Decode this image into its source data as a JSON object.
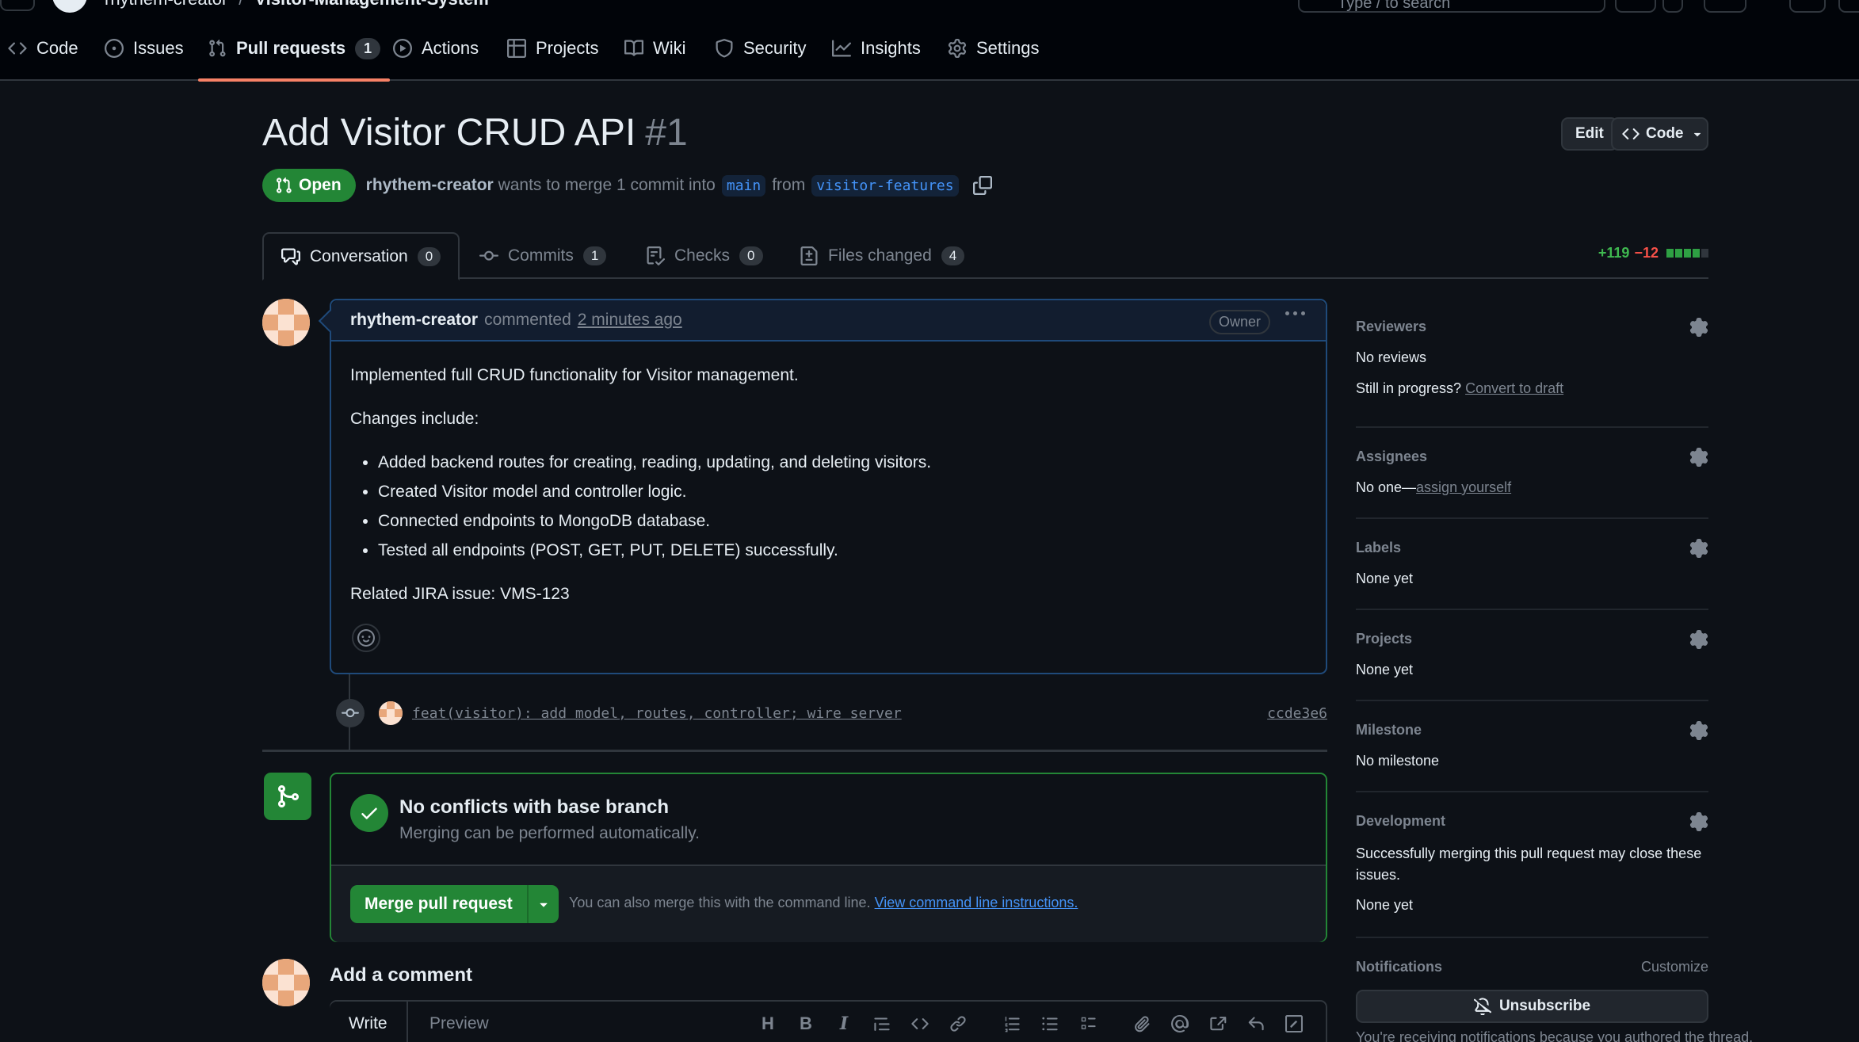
{
  "header": {
    "owner": "rhythem-creator",
    "separator": "/",
    "repo": "Visitor-Management-System",
    "search_placeholder": "Type / to search"
  },
  "repo_nav": {
    "items": [
      {
        "label": "Code",
        "icon": "code-icon"
      },
      {
        "label": "Issues",
        "icon": "issue-opened-icon"
      },
      {
        "label": "Pull requests",
        "icon": "git-pull-request-icon",
        "count": "1",
        "active": true
      },
      {
        "label": "Actions",
        "icon": "play-icon"
      },
      {
        "label": "Projects",
        "icon": "table-icon"
      },
      {
        "label": "Wiki",
        "icon": "book-icon"
      },
      {
        "label": "Security",
        "icon": "shield-icon"
      },
      {
        "label": "Insights",
        "icon": "graph-icon"
      },
      {
        "label": "Settings",
        "icon": "gear-icon"
      }
    ]
  },
  "pr": {
    "title": "Add Visitor CRUD API",
    "number": "#1",
    "edit_label": "Edit",
    "code_label": "Code",
    "state": "Open",
    "author": "rhythem-creator",
    "merge_text": "wants to merge 1 commit into",
    "base_branch": "main",
    "from_text": "from",
    "head_branch": "visitor-features"
  },
  "tabs": [
    {
      "label": "Conversation",
      "count": "0",
      "icon": "comment-discussion-icon"
    },
    {
      "label": "Commits",
      "count": "1",
      "icon": "git-commit-icon"
    },
    {
      "label": "Checks",
      "count": "0",
      "icon": "checklist-icon"
    },
    {
      "label": "Files changed",
      "count": "4",
      "icon": "file-diff-icon"
    }
  ],
  "diffstat": {
    "additions": "+119",
    "deletions": "−12",
    "bars_added": 4,
    "bars_total": 5
  },
  "comment": {
    "author": "rhythem-creator",
    "action": "commented",
    "time": "2 minutes ago",
    "badge": "Owner",
    "intro": "Implemented full CRUD functionality for Visitor management.",
    "changes_heading": "Changes include:",
    "bullets": [
      "Added backend routes for creating, reading, updating, and deleting visitors.",
      "Created Visitor model and controller logic.",
      "Connected endpoints to MongoDB database.",
      "Tested all endpoints (POST, GET, PUT, DELETE) successfully."
    ],
    "jira": "Related JIRA issue: VMS-123"
  },
  "commit": {
    "message": "feat(visitor): add model, routes, controller; wire server",
    "sha": "ccde3e6"
  },
  "merge": {
    "title": "No conflicts with base branch",
    "subtitle": "Merging can be performed automatically.",
    "button": "Merge pull request",
    "note": "You can also merge this with the command line.",
    "link": "View command line instructions."
  },
  "add_comment": {
    "title": "Add a comment",
    "write_tab": "Write",
    "preview_tab": "Preview"
  },
  "sidebar": {
    "reviewers": {
      "title": "Reviewers",
      "value": "No reviews",
      "draft_prefix": "Still in progress?",
      "draft_link": "Convert to draft"
    },
    "assignees": {
      "title": "Assignees",
      "value": "No one—",
      "link": "assign yourself"
    },
    "labels": {
      "title": "Labels",
      "value": "None yet"
    },
    "projects": {
      "title": "Projects",
      "value": "None yet"
    },
    "milestone": {
      "title": "Milestone",
      "value": "No milestone"
    },
    "development": {
      "title": "Development",
      "desc": "Successfully merging this pull request may close these issues.",
      "value": "None yet"
    },
    "notifications": {
      "title": "Notifications",
      "customize": "Customize",
      "button": "Unsubscribe",
      "footer": "You're receiving notifications because you authored the thread."
    }
  },
  "colors": {
    "accent_green": "#238636",
    "link_blue": "#4493f8",
    "active_tab": "#f78166",
    "bg": "#0d1117"
  }
}
